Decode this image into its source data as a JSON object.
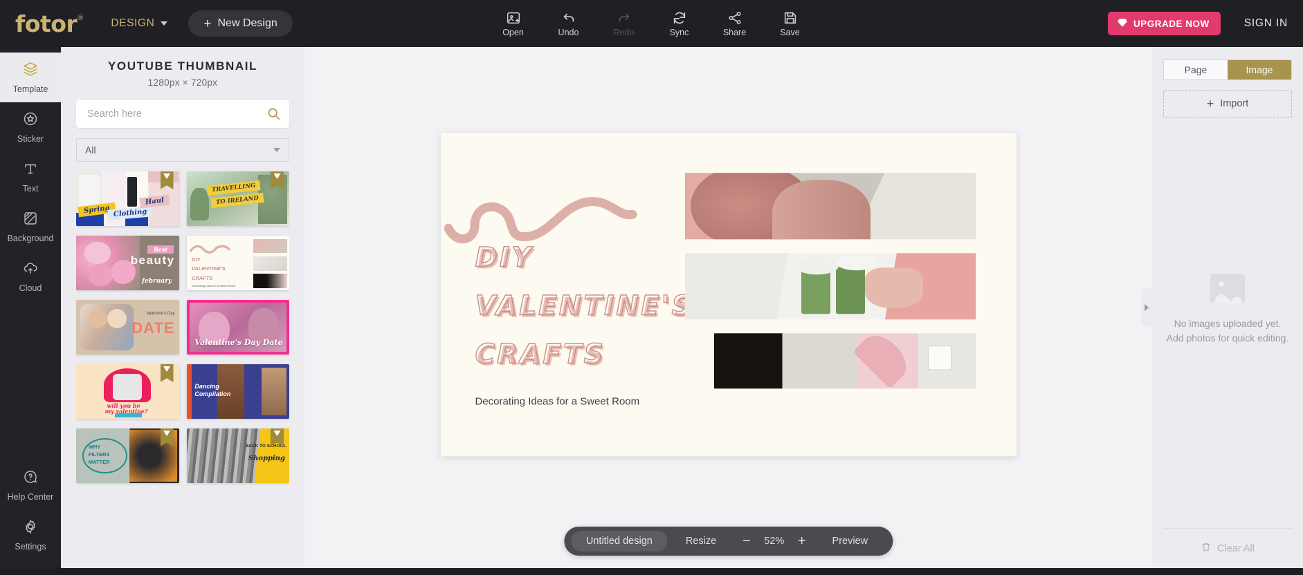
{
  "topbar": {
    "logo": "fotor",
    "logo_reg": "®",
    "design_menu": "DESIGN",
    "new_design": "New Design",
    "new_design_plus": "+",
    "tools": [
      {
        "label": "Open",
        "icon": "open-image-icon",
        "disabled": false
      },
      {
        "label": "Undo",
        "icon": "undo-icon",
        "disabled": false
      },
      {
        "label": "Redo",
        "icon": "redo-icon",
        "disabled": true
      },
      {
        "label": "Sync",
        "icon": "sync-icon",
        "disabled": false
      },
      {
        "label": "Share",
        "icon": "share-icon",
        "disabled": false
      },
      {
        "label": "Save",
        "icon": "save-icon",
        "disabled": false
      }
    ],
    "upgrade": "UPGRADE NOW",
    "upgrade_icon": "diamond-icon",
    "signin": "SIGN IN",
    "accent_gold": "#c9b273",
    "accent_pink": "#e33a6e"
  },
  "rail": {
    "items": [
      {
        "label": "Template",
        "icon": "layers-icon",
        "active": true
      },
      {
        "label": "Sticker",
        "icon": "star-badge-icon",
        "active": false
      },
      {
        "label": "Text",
        "icon": "text-t-icon",
        "active": false
      },
      {
        "label": "Background",
        "icon": "hatched-square-icon",
        "active": false
      },
      {
        "label": "Cloud",
        "icon": "cloud-upload-icon",
        "active": false
      }
    ],
    "bottom": [
      {
        "label": "Help Center",
        "icon": "question-bubble-icon"
      },
      {
        "label": "Settings",
        "icon": "gear-icon"
      }
    ]
  },
  "panel": {
    "title": "YOUTUBE THUMBNAIL",
    "subtitle": "1280px × 720px",
    "search_value": "",
    "search_placeholder": "Search here",
    "search_icon": "search-icon",
    "filter_value": "All",
    "filter_icon": "chevron-down-icon",
    "templates": [
      {
        "name": "Spring Clothing Haul",
        "words": [
          "Spring",
          "Clothing",
          "Haul"
        ],
        "premium": true
      },
      {
        "name": "Travelling to Ireland",
        "words": [
          "TRAVELLING",
          "TO IRELAND"
        ],
        "premium": true
      },
      {
        "name": "Best beauty february",
        "words": [
          "Best",
          "beauty",
          "february"
        ],
        "premium": false
      },
      {
        "name": "DIY Valentine's Crafts",
        "words": [
          "DIY",
          "VALENTINE'S",
          "CRAFTS"
        ],
        "premium": false
      },
      {
        "name": "Valentine's Day DATE",
        "words": [
          "Valentine's Day",
          "DATE"
        ],
        "premium": false
      },
      {
        "name": "Valentine's Day Date",
        "words": [
          "Valentine's Day Date"
        ],
        "premium": false
      },
      {
        "name": "Will you be my valentine",
        "words": [
          "will you be",
          "my valentine?"
        ],
        "premium": true
      },
      {
        "name": "Dancing Compilation",
        "words": [
          "Dancing",
          "Compilation"
        ],
        "premium": false
      },
      {
        "name": "Why Filters Matter",
        "words": [
          "WHY",
          "FILTERS",
          "MATTER"
        ],
        "premium": true
      },
      {
        "name": "Back to School Shopping",
        "words": [
          "BACK TO SCHOOL",
          "Shopping"
        ],
        "premium": true
      }
    ]
  },
  "canvas": {
    "headline_line1": "DIY",
    "headline_line2": "VALENTINE'S",
    "headline_line3": "CRAFTS",
    "subtitle": "Decorating Ideas for a Sweet Room",
    "background_color": "#fdfaf2",
    "headline_color": "#c58f8a",
    "shadow_color": "#e8bdb4"
  },
  "rpanel": {
    "tabs": [
      {
        "label": "Page",
        "active": false
      },
      {
        "label": "Image",
        "active": true
      }
    ],
    "import_label": "Import",
    "import_plus": "+",
    "empty_icon": "image-placeholder-icon",
    "empty_text": "No images uploaded yet. Add photos for quick editing.",
    "clear_all": "Clear All",
    "clear_icon": "trash-icon",
    "collapse_icon": "chevron-right-icon"
  },
  "bottombar": {
    "doc_name": "Untitled design",
    "resize": "Resize",
    "zoom_out": "−",
    "zoom_value": "52%",
    "zoom_in": "+",
    "preview": "Preview"
  }
}
